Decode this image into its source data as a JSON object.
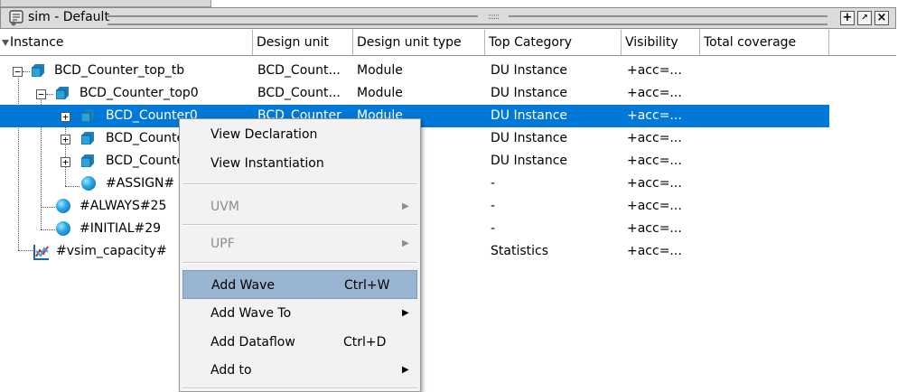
{
  "window": {
    "title": "sim - Default",
    "grip_dots": "::::::"
  },
  "columns": [
    "Instance",
    "Design unit",
    "Design unit type",
    "Top Category",
    "Visibility",
    "Total coverage"
  ],
  "rows": [
    {
      "name": "BCD_Counter_top_tb",
      "design_unit": "BCD_Count...",
      "type": "Module",
      "category": "DU Instance",
      "visibility": "+acc=..."
    },
    {
      "name": "BCD_Counter_top0",
      "design_unit": "BCD_Count...",
      "type": "Module",
      "category": "DU Instance",
      "visibility": "+acc=..."
    },
    {
      "name": "BCD_Counter0",
      "design_unit": "BCD_Counter",
      "type": "Module",
      "category": "DU Instance",
      "visibility": "+acc=..."
    },
    {
      "name": "BCD_Counter1",
      "design_unit": "",
      "type": "",
      "category": "DU Instance",
      "visibility": "+acc=..."
    },
    {
      "name": "BCD_Counter2",
      "design_unit": "",
      "type": "",
      "category": "DU Instance",
      "visibility": "+acc=..."
    },
    {
      "name": "#ASSIGN#",
      "design_unit": "",
      "type": "",
      "category": "-",
      "visibility": "+acc=..."
    },
    {
      "name": "#ALWAYS#25",
      "design_unit": "",
      "type": "",
      "category": "-",
      "visibility": "+acc=..."
    },
    {
      "name": "#INITIAL#29",
      "design_unit": "",
      "type": "",
      "category": "-",
      "visibility": "+acc=..."
    },
    {
      "name": "#vsim_capacity#",
      "design_unit": "",
      "type": "",
      "category": "Statistics",
      "visibility": "+acc=..."
    }
  ],
  "context_menu": {
    "items": [
      {
        "label": "View Declaration",
        "shortcut": ""
      },
      {
        "label": "View Instantiation",
        "shortcut": ""
      },
      {
        "label": "UVM",
        "shortcut": ""
      },
      {
        "label": "UPF",
        "shortcut": ""
      },
      {
        "label": "Add Wave",
        "shortcut": "Ctrl+W"
      },
      {
        "label": "Add Wave To",
        "shortcut": ""
      },
      {
        "label": "Add Dataflow",
        "shortcut": "Ctrl+D"
      },
      {
        "label": "Add to",
        "shortcut": ""
      }
    ]
  },
  "colors": {
    "selection": "#0078d7",
    "menu_highlight": "#99b4d1",
    "disabled_text": "#8d8d8d"
  },
  "icons": {
    "title": "sim-structure-icon",
    "module": "module-instance-icon",
    "process": "process-ball-icon",
    "statistics": "statistics-chart-icon"
  }
}
